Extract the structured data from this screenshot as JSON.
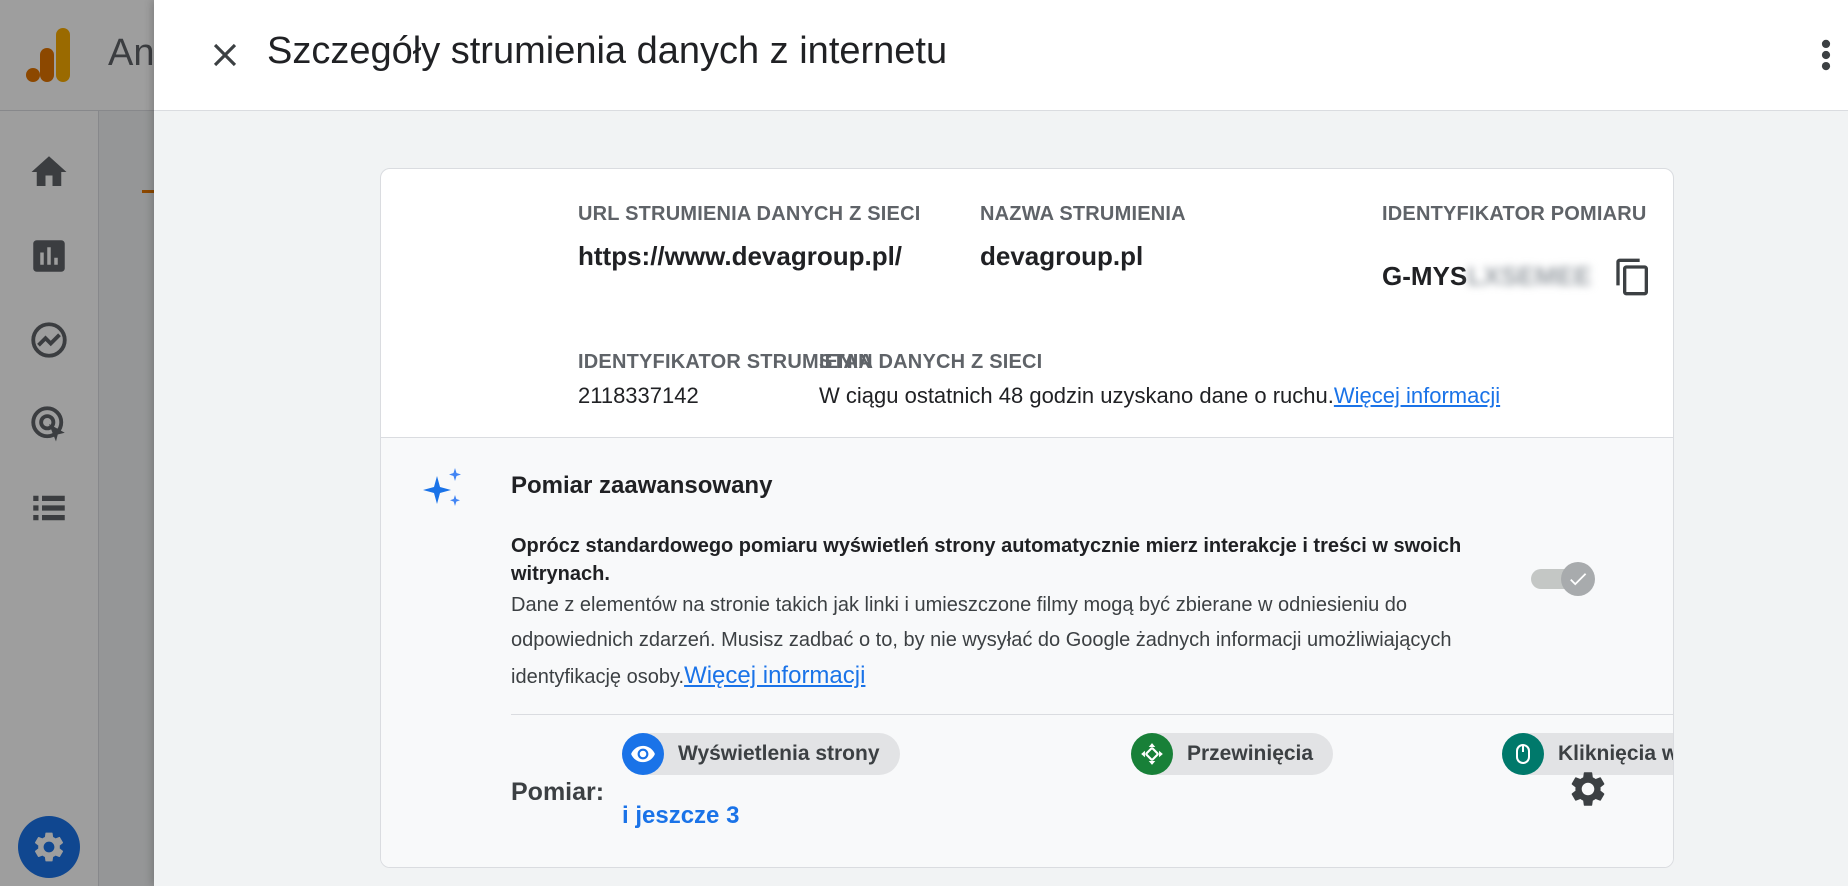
{
  "app": {
    "name_fragment": "An"
  },
  "panel": {
    "title": "Szczegóły strumienia danych z internetu"
  },
  "details": {
    "url_label": "URL STRUMIENIA DANYCH Z SIECI",
    "url_value": "https://www.devagroup.pl/",
    "name_label": "NAZWA STRUMIENIA",
    "name_value": "devagroup.pl",
    "measurement_label": "IDENTYFIKATOR POMIARU",
    "measurement_value_visible": "G-MYS",
    "measurement_value_blurred": "LXSEMEE",
    "stream_id_label": "IDENTYFIKATOR STRUMIENIA",
    "stream_id_value": "2118337142",
    "status_label": "STAN DANYCH Z SIECI",
    "status_text": "W ciągu ostatnich 48 godzin uzyskano dane o ruchu.",
    "status_link": "Więcej informacji"
  },
  "advanced": {
    "title": "Pomiar zaawansowany",
    "description_strong": "Oprócz standardowego pomiaru wyświetleń strony automatycznie mierz interakcje i treści w swoich witrynach.",
    "description_body": "Dane z elementów na stronie takich jak linki i umieszczone filmy mogą być zbierane w odniesieniu do odpowiednich zdarzeń. Musisz zadbać o to, by nie wysyłać do Google żadnych informacji umożliwiających identyfikację osoby.",
    "description_link": "Więcej informacji",
    "toggle_on": true,
    "measurement_label": "Pomiar:",
    "chips": [
      {
        "label": "Wyświetlenia strony",
        "icon": "eye-icon",
        "color": "#1a73e8"
      },
      {
        "label": "Przewinięcia",
        "icon": "scroll-arrows-icon",
        "color": "#188038"
      },
      {
        "label": "Kliknięcia wychodzące",
        "icon": "mouse-icon",
        "color": "#00796b"
      }
    ],
    "more_chips": "i jeszcze 3"
  },
  "colors": {
    "accent": "#1a73e8",
    "logo_orange": "#f9ab00",
    "logo_dark_orange": "#e37400"
  }
}
